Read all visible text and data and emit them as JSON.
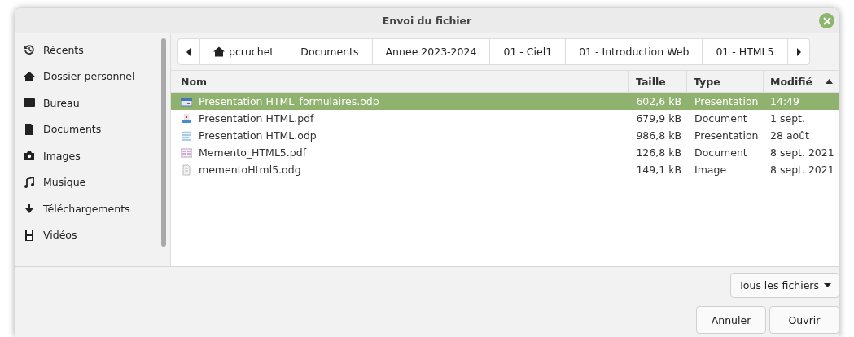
{
  "window": {
    "title": "Envoi du fichier"
  },
  "sidebar": {
    "items": [
      {
        "kind": "recent",
        "label": "Récents"
      },
      {
        "kind": "home",
        "label": "Dossier personnel"
      },
      {
        "kind": "desktop",
        "label": "Bureau"
      },
      {
        "kind": "documents",
        "label": "Documents"
      },
      {
        "kind": "images",
        "label": "Images"
      },
      {
        "kind": "music",
        "label": "Musique"
      },
      {
        "kind": "downloads",
        "label": "Téléchargements"
      },
      {
        "kind": "videos",
        "label": "Vidéos"
      }
    ]
  },
  "path_bar": {
    "segments": [
      {
        "label": "pcruchet",
        "home": true
      },
      {
        "label": "Documents",
        "home": false
      },
      {
        "label": "Annee 2023-2024",
        "home": false
      },
      {
        "label": "01 - Ciel1",
        "home": false
      },
      {
        "label": "01 - Introduction Web",
        "home": false
      },
      {
        "label": "01 - HTML5",
        "home": false
      }
    ]
  },
  "table": {
    "columns": [
      {
        "label": "Nom",
        "sorted": false
      },
      {
        "label": "Taille",
        "sorted": false
      },
      {
        "label": "Type",
        "sorted": false
      },
      {
        "label": "Modifié",
        "sorted": true
      }
    ],
    "rows": [
      {
        "kind": "presentation",
        "name": "Presentation HTML_formulaires.odp",
        "size": "602,6 kB",
        "type": "Presentation",
        "modified": "14:49",
        "selected": true
      },
      {
        "kind": "pdf",
        "name": "Presentation HTML.pdf",
        "size": "679,9 kB",
        "type": "Document",
        "modified": "1 sept.",
        "selected": false
      },
      {
        "kind": "slides",
        "name": "Presentation HTML.odp",
        "size": "986,8 kB",
        "type": "Presentation",
        "modified": "28 août",
        "selected": false
      },
      {
        "kind": "pdf2",
        "name": "Memento_HTML5.pdf",
        "size": "126,8 kB",
        "type": "Document",
        "modified": "8 sept. 2021",
        "selected": false
      },
      {
        "kind": "drawing",
        "name": "mementoHtml5.odg",
        "size": "149,1 kB",
        "type": "Image",
        "modified": "8 sept. 2021",
        "selected": false
      }
    ]
  },
  "filter": {
    "label": "Tous les fichiers"
  },
  "buttons": [
    "Annuler",
    "Ouvrir"
  ]
}
